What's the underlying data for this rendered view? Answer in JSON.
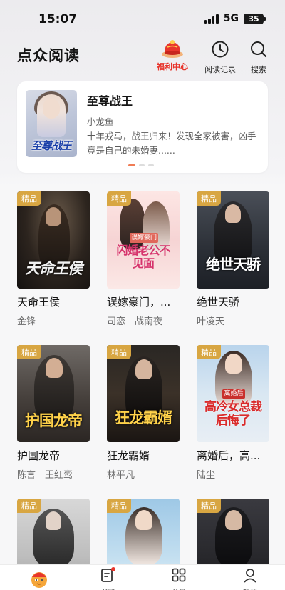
{
  "status_bar": {
    "time": "15:07",
    "network": "5G",
    "battery": "35"
  },
  "header": {
    "title": "点众阅读",
    "actions": [
      {
        "label": "福利中心",
        "icon": "gift-hat-icon"
      },
      {
        "label": "阅读记录",
        "icon": "clock-icon"
      },
      {
        "label": "搜索",
        "icon": "search-icon"
      }
    ]
  },
  "featured": {
    "title": "至尊战王",
    "cover_text": "至尊战王",
    "author": "小龙鱼",
    "description": "十年戎马，战王归来！发现全家被害，凶手竟是自己的未婚妻......"
  },
  "books": [
    {
      "badge": "精品",
      "title": "天命王侯",
      "author": "金锋",
      "cover_text": "天命王侯"
    },
    {
      "badge": "精品",
      "title": "误嫁豪门，...",
      "author": "司恋　战南夜",
      "cover_text": "闪婚老公不见面",
      "cover_subtext": "误嫁豪门"
    },
    {
      "badge": "精品",
      "title": "绝世天骄",
      "author": "叶凌天",
      "cover_text": "绝世天骄"
    },
    {
      "badge": "精品",
      "title": "护国龙帝",
      "author": "陈言　王红鸾",
      "cover_text": "护国龙帝"
    },
    {
      "badge": "精品",
      "title": "狂龙霸婿",
      "author": "林平凡",
      "cover_text": "狂龙霸婿"
    },
    {
      "badge": "精品",
      "title": "离婚后，高...",
      "author": "陆尘",
      "cover_text": "高冷女总裁后悔了",
      "cover_subtext": "离婚后"
    },
    {
      "badge": "精品"
    },
    {
      "badge": "精品"
    },
    {
      "badge": "精品"
    }
  ],
  "tabbar": {
    "items": [
      {
        "label": "",
        "icon": "mascot-icon"
      },
      {
        "label": "书城",
        "icon": "bookstore-icon"
      },
      {
        "label": "分类",
        "icon": "category-grid-icon"
      },
      {
        "label": "我的",
        "icon": "profile-icon"
      }
    ]
  }
}
